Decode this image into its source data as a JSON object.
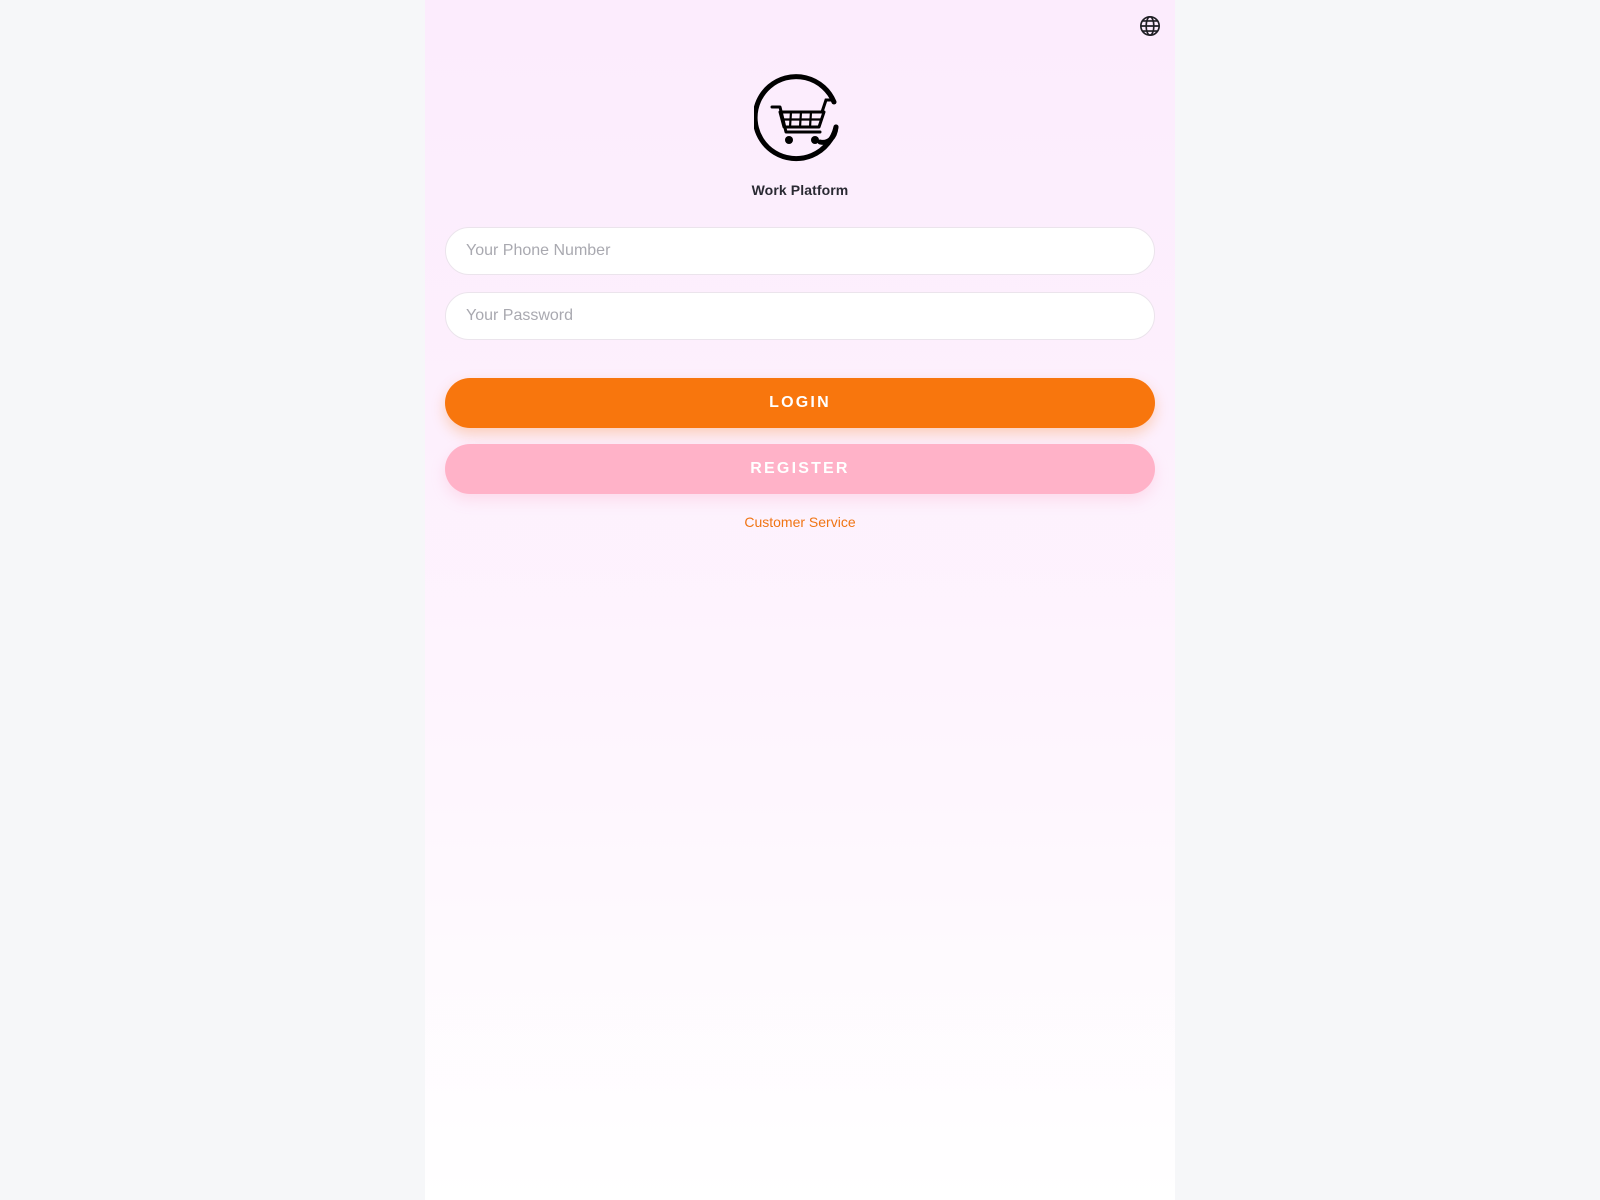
{
  "header": {
    "language_icon": "globe-icon"
  },
  "brand": {
    "logo_icon": "shopping-cart-at-logo",
    "name": "Work Platform"
  },
  "form": {
    "phone_placeholder": "Your Phone Number",
    "phone_value": "",
    "password_placeholder": "Your Password",
    "password_value": ""
  },
  "actions": {
    "login_label": "LOGIN",
    "register_label": "REGISTER",
    "customer_service_label": "Customer Service"
  },
  "colors": {
    "login_button": "#f8760d",
    "register_button": "#ffb2c8",
    "link": "#f07514",
    "background_top": "#fcecfd",
    "page_background": "#f6f7f9"
  }
}
